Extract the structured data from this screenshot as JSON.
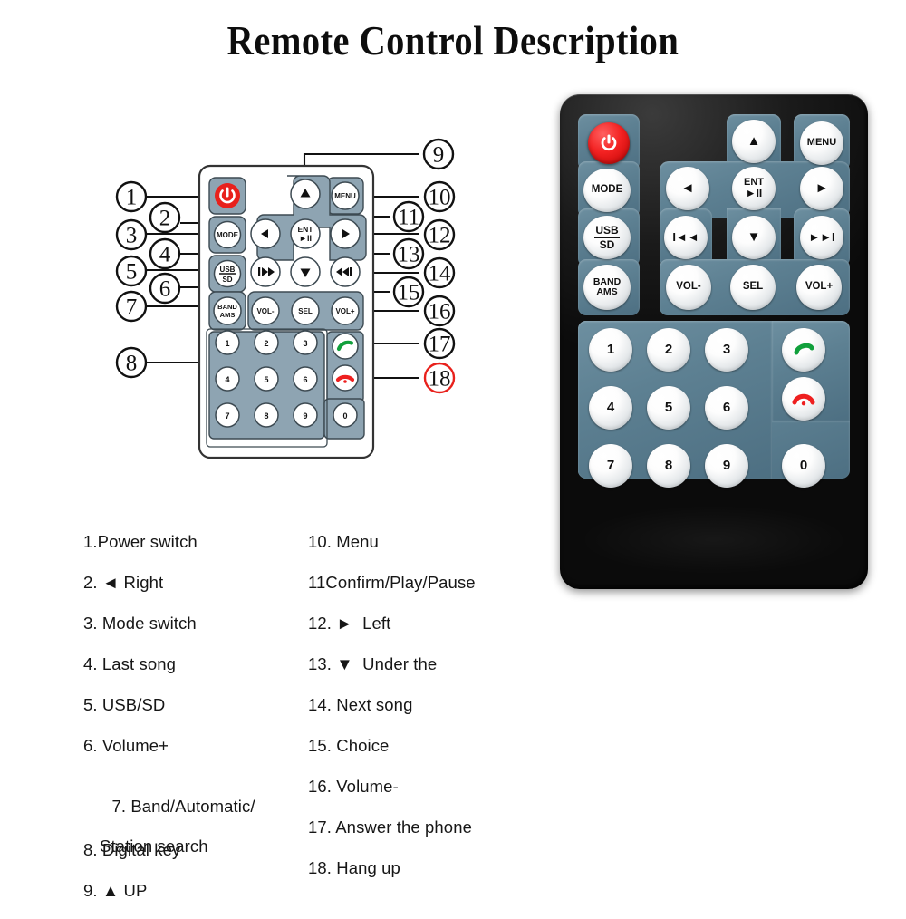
{
  "title": "Remote Control Description",
  "diagram": {
    "callouts": [
      {
        "n": "1"
      },
      {
        "n": "2"
      },
      {
        "n": "3"
      },
      {
        "n": "4"
      },
      {
        "n": "5"
      },
      {
        "n": "6"
      },
      {
        "n": "7"
      },
      {
        "n": "8"
      },
      {
        "n": "9"
      },
      {
        "n": "10"
      },
      {
        "n": "11"
      },
      {
        "n": "12"
      },
      {
        "n": "13"
      },
      {
        "n": "14"
      },
      {
        "n": "15"
      },
      {
        "n": "16"
      },
      {
        "n": "17"
      },
      {
        "n": "18"
      }
    ],
    "callout_18_color": "#e8211c",
    "callout_default_color": "#111111"
  },
  "remote": {
    "buttons": {
      "power": "power-icon",
      "up": "▲",
      "menu": "MENU",
      "mode": "MODE",
      "left": "◄",
      "ent_top": "ENT",
      "ent_bottom": "►II",
      "right": "►",
      "usb_top": "USB",
      "usb_bottom": "SD",
      "prev": "I◄◄",
      "down": "▼",
      "next": "►►I",
      "band_top": "BAND",
      "band_bottom": "AMS",
      "vol_minus": "VOL-",
      "sel": "SEL",
      "vol_plus": "VOL+",
      "keys": [
        "1",
        "2",
        "3",
        "4",
        "5",
        "6",
        "7",
        "8",
        "9",
        "0"
      ],
      "answer": "answer-call-icon",
      "hangup": "hang-up-icon"
    },
    "colors": {
      "body": "#0b0b0b",
      "panel": "#5d8092",
      "button": "#f4f6f7",
      "power": "#ee1c1c",
      "answer": "#11a03c",
      "hangup": "#ee1f1f"
    }
  },
  "legend": {
    "left_column": [
      {
        "id": "1",
        "text": "1.Power switch"
      },
      {
        "id": "2",
        "text": "2. ◄ Right"
      },
      {
        "id": "3",
        "text": "3. Mode switch"
      },
      {
        "id": "4",
        "text": "4. Last song"
      },
      {
        "id": "5",
        "text": "5. USB/SD"
      },
      {
        "id": "6",
        "text": "6. Volume+"
      },
      {
        "id": "7",
        "text": "7. Band/Automatic/",
        "text2": "Station search"
      },
      {
        "id": "8",
        "text": "8. Digital key"
      },
      {
        "id": "9",
        "text": "9. ▲ UP"
      }
    ],
    "right_column": [
      {
        "id": "10",
        "text": "10. Menu"
      },
      {
        "id": "11",
        "text": "11Confirm/Play/Pause"
      },
      {
        "id": "12",
        "text": "12. ►  Left"
      },
      {
        "id": "13",
        "text": "13. ▼  Under the"
      },
      {
        "id": "14",
        "text": "14. Next song"
      },
      {
        "id": "15",
        "text": "15. Choice"
      },
      {
        "id": "16",
        "text": "16. Volume-"
      },
      {
        "id": "17",
        "text": "17. Answer the phone"
      },
      {
        "id": "18",
        "text": "18. Hang up"
      }
    ]
  }
}
